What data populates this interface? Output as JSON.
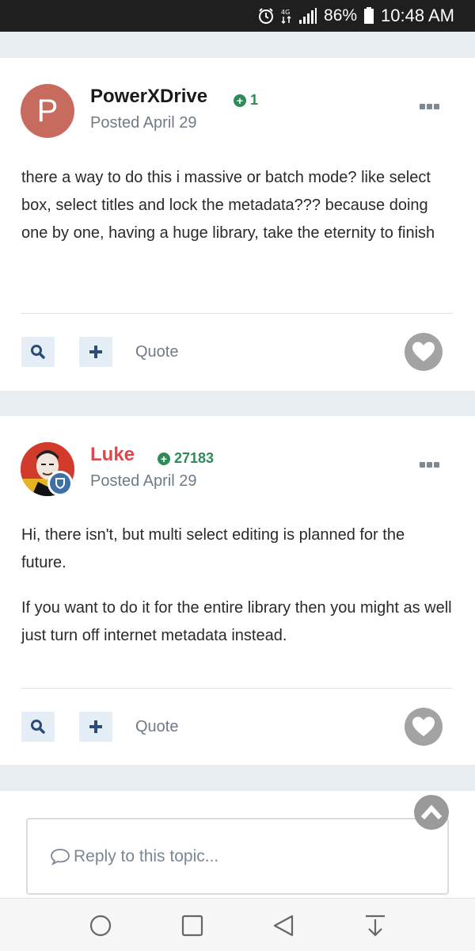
{
  "status_bar": {
    "battery_pct": "86%",
    "time": "10:48 AM",
    "network": "4G"
  },
  "posts": [
    {
      "avatar_letter": "P",
      "author": "PowerXDrive",
      "reputation": "1",
      "posted": "Posted April 29",
      "body": [
        "there a way to do this i massive or batch mode? like select box, select titles and lock the metadata??? because doing one by one, having a huge library, take the eternity to finish"
      ],
      "quote_label": "Quote"
    },
    {
      "author": "Luke",
      "reputation": "27183",
      "posted": "Posted April 29",
      "body": [
        "Hi, there isn't, but multi select editing is planned for the future.",
        "If you want to do it for the entire library then you might as well just turn off internet metadata instead."
      ],
      "quote_label": "Quote"
    }
  ],
  "reply": {
    "placeholder": "Reply to this topic..."
  },
  "colors": {
    "accent_red": "#e0474c",
    "rep_green": "#2e8b57",
    "avatar_bg": "#c86b5f",
    "action_blue": "#2a4d75"
  }
}
